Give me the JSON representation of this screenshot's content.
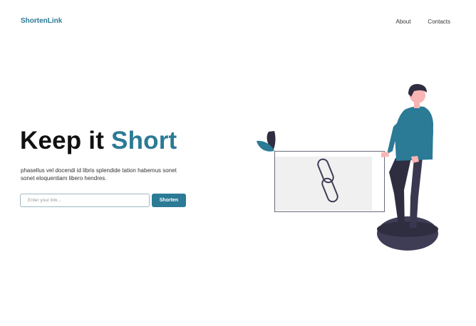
{
  "header": {
    "brand": "ShortenLink",
    "nav": [
      {
        "label": "About"
      },
      {
        "label": "Contacts"
      }
    ]
  },
  "hero": {
    "title_main": "Keep it",
    "title_accent": "Short",
    "description": "phasellus vel docendi id libris splendide tation habemus sonet sonet eloquentiam libero hendres."
  },
  "form": {
    "input_value": "",
    "input_placeholder": "Enter your link...",
    "button_label": "Shorten"
  },
  "colors": {
    "accent": "#2b7a96",
    "dark": "#2f2e41",
    "skin": "#f9b4b4"
  },
  "illustration": {
    "icon": "chain-link-icon"
  }
}
